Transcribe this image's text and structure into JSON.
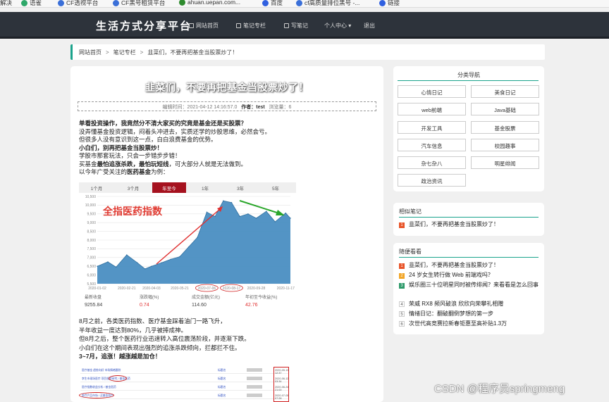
{
  "bookmarks": [
    {
      "label": "解决",
      "icon": "bookmark-icon",
      "color": "#444444"
    },
    {
      "label": "语雀",
      "icon": "leaf-icon",
      "color": "#2ea86a"
    },
    {
      "label": "CF透视平台",
      "icon": "globe-icon",
      "color": "#3a6fd8"
    },
    {
      "label": "CF黑号租赁平台",
      "icon": "globe-icon",
      "color": "#3a6fd8"
    },
    {
      "label": "ahuan.uepan.com...",
      "icon": "tree-icon",
      "color": "#2e8b2e"
    },
    {
      "label": "百度",
      "icon": "paw-icon",
      "color": "#3060e0"
    },
    {
      "label": "cf高质量排位黑号 -...",
      "icon": "globe-icon",
      "color": "#3a6fd8"
    },
    {
      "label": "链接",
      "icon": "paw-icon",
      "color": "#3060e0"
    }
  ],
  "header": {
    "logo": "生活方式分享平台",
    "nav": [
      "网站首页",
      "笔记专栏",
      "写笔记",
      "个人中心",
      "退出"
    ]
  },
  "breadcrumb": [
    "网站首页",
    "笔记专栏",
    "韭菜们，不要再把基金当股票炒了！"
  ],
  "article": {
    "title": "韭菜们，不要再把基金当股票炒了！",
    "meta": {
      "time_label": "编辑时间：",
      "time": "2021-04-12 14:16:57.0",
      "author_label": "作者：",
      "author": "test",
      "views_label": "浏览量：",
      "views": "6"
    },
    "para1": [
      "单看投资操作，我竟然分不清大家买的究竟是基金还是买股票？",
      "没弄懂基金投资逻辑，闷着头冲进去，实质还学的炒股思维，必然会亏。",
      "但很多人没有意识到这一点，白白浪费基金的优势。",
      "小白们，别再把基金当股票炒！",
      "学股市那套玩法，只会一步错步步错！"
    ],
    "para1_line6": {
      "a": "买基金",
      "b": "最怕追涨杀跌，最怕玩短线",
      "c": "，可大部分人就是无法做到。"
    },
    "para1_line7": {
      "a": "以今年广受关注的",
      "b": "医药基金",
      "c": "为例："
    },
    "para2": [
      "8月之前，各类医药指数、医疗基金踩着油门一路飞升，",
      "半年收益一度达到80%，几乎被捧成神。",
      "但8月之后，整个医药行业迅速转入高位震荡阶段，并逐渐下跌。",
      "小白们在这个期间表现出强烈的追涨杀跌倾向，拦都拦不住。",
      "3~7月，追涨！越涨越是加仓！"
    ],
    "mini_table": [
      {
        "a": "医疗基金 趋势向好 市场情绪跟踪",
        "b": "2020-05-13 12:37"
      },
      {
        "a": "李生市现场医疗 项目投资研究 / 基金医药",
        "b": "2020-06-12 03:34"
      },
      {
        "a": "医疗指数收益分析 / 基金医药",
        "b": "2020-06-24 21:00"
      },
      {
        "a": "医疗产品市场 / 买基金医疗",
        "b": "2020-07-05 07:28"
      }
    ],
    "mini_table_col": "标题名"
  },
  "fund_widget": {
    "tabs": [
      "1个月",
      "3个月",
      "年至今",
      "1年",
      "3年",
      "5年"
    ],
    "active_tab": 2,
    "annotation": "全指医药指数",
    "stats": [
      {
        "label": "最新收盘",
        "value": "9255.84"
      },
      {
        "label": "涨跌幅(%)",
        "value": "0.74"
      },
      {
        "label": "成交金额(亿元)",
        "value": "114.60"
      },
      {
        "label": "年初至今收益(%)",
        "value": "42.76"
      }
    ]
  },
  "chart_data": {
    "type": "area",
    "title": "全指医药指数",
    "x_tick_labels": [
      "2020-01-02",
      "2020-02-21",
      "2020-04-03",
      "2020-05-21",
      "2020-07-06",
      "2020-08-17",
      "2020-09-28",
      "2020-11-17"
    ],
    "y_tick_labels": [
      "10,500",
      "10,000",
      "9,500",
      "9,000",
      "8,500",
      "8,000",
      "7,500",
      "7,000",
      "6,500",
      "6,000",
      "5,500"
    ],
    "ylim": [
      5500,
      10500
    ],
    "series": [
      {
        "x": [
          "2020-01-02",
          "2020-01-20",
          "2020-02-03",
          "2020-02-21",
          "2020-03-10",
          "2020-03-23",
          "2020-04-03",
          "2020-04-20",
          "2020-05-06",
          "2020-05-21",
          "2020-06-05",
          "2020-06-20",
          "2020-07-06",
          "2020-07-20",
          "2020-08-03",
          "2020-08-17",
          "2020-08-31",
          "2020-09-14",
          "2020-09-28",
          "2020-10-15",
          "2020-10-30",
          "2020-11-17",
          "2020-11-25"
        ],
        "values": [
          6500,
          6750,
          6450,
          7150,
          6700,
          6350,
          6500,
          6700,
          6900,
          7050,
          7600,
          8150,
          9600,
          9350,
          10250,
          10150,
          9350,
          9500,
          9250,
          9650,
          9050,
          9550,
          9250
        ]
      }
    ],
    "color": "#4a8ec2",
    "grid": true
  },
  "sidebar": {
    "categories_title": "分类导航",
    "categories": [
      "心情日记",
      "美食日记",
      "web前端",
      "Java基础",
      "开发工具",
      "基金股票",
      "汽车信息",
      "校园趣事",
      "杂七杂八",
      "明星绯闻",
      "政治资讯"
    ],
    "related_title": "相似笔记",
    "related": [
      {
        "rank": "1",
        "title": "韭菜们，不要再把基金当股票炒了！"
      }
    ],
    "random_title": "随便看看",
    "random": [
      {
        "rank": "1",
        "title": "韭菜们，不要再把基金当股票炒了！"
      },
      {
        "rank": "2",
        "title": "24 岁女生转行做 Web 前端戏吗？"
      },
      {
        "rank": "3",
        "title": "娱乐圈三十位明星同时被传绯闻？来看看是怎么回事"
      },
      {
        "rank": "4",
        "title": "荣威 RX8 频风破浪 欣欣向荣攀礼相赠"
      },
      {
        "rank": "5",
        "title": "情绪日记：翻破翻倒梦想的第一步"
      },
      {
        "rank": "6",
        "title": "次世代高竞赛拉新春钜惠至高补贴1.3万"
      }
    ]
  },
  "watermark": "CSDN @程序员springmeng"
}
